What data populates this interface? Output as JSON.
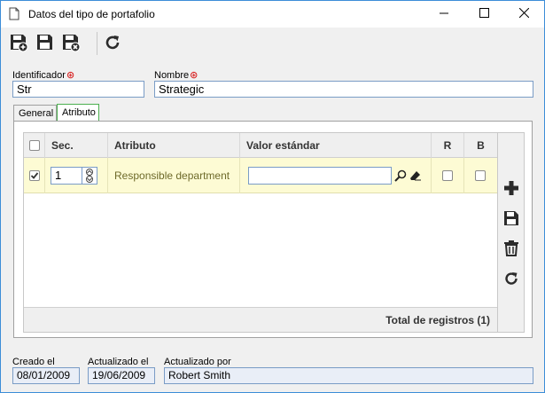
{
  "window": {
    "title": "Datos del tipo de portafolio"
  },
  "form": {
    "identificador_label": "Identificador",
    "identificador_value": "Str",
    "nombre_label": "Nombre",
    "nombre_value": "Strategic"
  },
  "tabs": [
    {
      "label": "General",
      "active": false
    },
    {
      "label": "Atributo",
      "active": true
    }
  ],
  "grid": {
    "columns": [
      "Sec.",
      "Atributo",
      "Valor estándar",
      "R",
      "B"
    ],
    "rows": [
      {
        "checked": true,
        "sec": "1",
        "atributo": "Responsible department",
        "valor": "",
        "r": false,
        "b": false
      }
    ],
    "footer": "Total de registros (1)"
  },
  "meta": {
    "creado_label": "Creado el",
    "creado_value": "08/01/2009",
    "actualizado_label": "Actualizado el",
    "actualizado_value": "19/06/2009",
    "actualizado_por_label": "Actualizado por",
    "actualizado_por_value": "Robert Smith"
  },
  "colors": {
    "window_border": "#3c8dd8",
    "row_highlight": "#fdfbd4",
    "active_tab_border": "#4caf50",
    "required_marker": "#d40000"
  },
  "icons": {
    "toolbar": [
      "save-new-icon",
      "save-icon",
      "save-close-icon",
      "refresh-icon"
    ],
    "side": [
      "add-icon",
      "save-icon",
      "delete-icon",
      "refresh-icon"
    ]
  }
}
